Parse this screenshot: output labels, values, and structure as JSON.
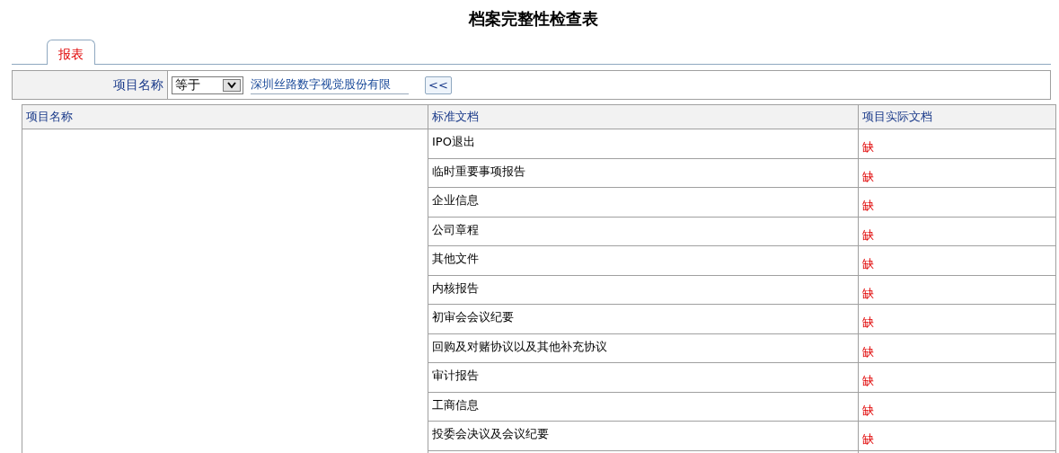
{
  "title": "档案完整性检查表",
  "tabs": [
    {
      "label": "报表",
      "selected": true
    }
  ],
  "filter": {
    "label": "项目名称",
    "operator": "等于",
    "value": "深圳丝路数字视觉股份有限",
    "button": "<<"
  },
  "table": {
    "columns": [
      "项目名称",
      "标准文档",
      "项目实际文档"
    ],
    "rows": [
      {
        "standard": "IPO退出",
        "actual": "缺"
      },
      {
        "standard": "临时重要事项报告",
        "actual": "缺"
      },
      {
        "standard": "企业信息",
        "actual": "缺"
      },
      {
        "standard": "公司章程",
        "actual": "缺"
      },
      {
        "standard": "其他文件",
        "actual": "缺"
      },
      {
        "standard": "内核报告",
        "actual": "缺"
      },
      {
        "standard": "初审会会议纪要",
        "actual": "缺"
      },
      {
        "standard": "回购及对赌协议以及其他补充协议",
        "actual": "缺"
      },
      {
        "standard": "审计报告",
        "actual": "缺"
      },
      {
        "standard": "工商信息",
        "actual": "缺"
      },
      {
        "standard": "投委会决议及会议纪要",
        "actual": "缺"
      }
    ]
  }
}
